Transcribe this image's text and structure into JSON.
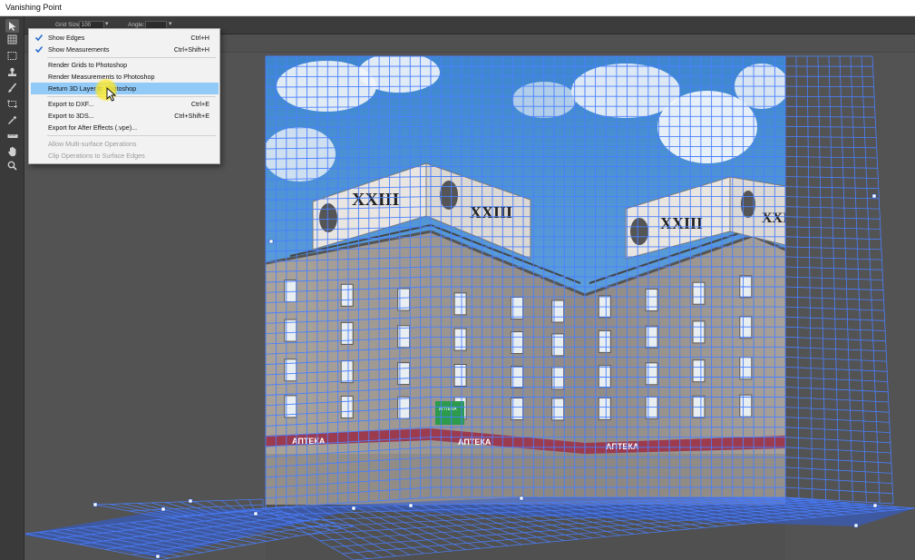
{
  "window": {
    "title": "Vanishing Point"
  },
  "options_bar": {
    "grid_size_label": "Grid Size:",
    "grid_size_value": "100",
    "angle_label": "Angle:"
  },
  "tools": [
    {
      "name": "edit-plane-tool-icon"
    },
    {
      "name": "create-plane-tool-icon"
    },
    {
      "name": "marquee-tool-icon"
    },
    {
      "name": "stamp-tool-icon"
    },
    {
      "name": "brush-tool-icon"
    },
    {
      "name": "transform-tool-icon"
    },
    {
      "name": "eyedropper-tool-icon"
    },
    {
      "name": "measure-tool-icon"
    },
    {
      "name": "hand-tool-icon"
    },
    {
      "name": "zoom-tool-icon"
    }
  ],
  "menu": {
    "items": [
      {
        "label": "Show Edges",
        "shortcut": "Ctrl+H",
        "checked": true
      },
      {
        "label": "Show Measurements",
        "shortcut": "Ctrl+Shift+H",
        "checked": true
      },
      {
        "label": "Render Grids to Photoshop",
        "shortcut": ""
      },
      {
        "label": "Render Measurements to Photoshop",
        "shortcut": ""
      },
      {
        "label": "Return 3D Layer to Photoshop",
        "shortcut": "",
        "highlighted": true
      },
      {
        "label": "Export to DXF...",
        "shortcut": "Ctrl+E"
      },
      {
        "label": "Export to 3DS...",
        "shortcut": "Ctrl+Shift+E"
      },
      {
        "label": "Export for After Effects (.vpe)...",
        "shortcut": ""
      },
      {
        "label": "Allow Multi-surface Operations",
        "shortcut": "",
        "disabled": true
      },
      {
        "label": "Clip Operations to Surface Edges",
        "shortcut": "",
        "disabled": true
      }
    ]
  },
  "photo": {
    "billboard_text": "XXIII",
    "storefront_text": "АПТЕКА",
    "sign_text": "АПТЕКА"
  },
  "colors": {
    "grid_line": "#4a7fff",
    "menu_highlight": "#91c9f7",
    "cursor_highlight": "#f5e62a",
    "sky": "#4a95d6",
    "facade": "#9a9590",
    "storefront_band": "#9c3a4e"
  }
}
